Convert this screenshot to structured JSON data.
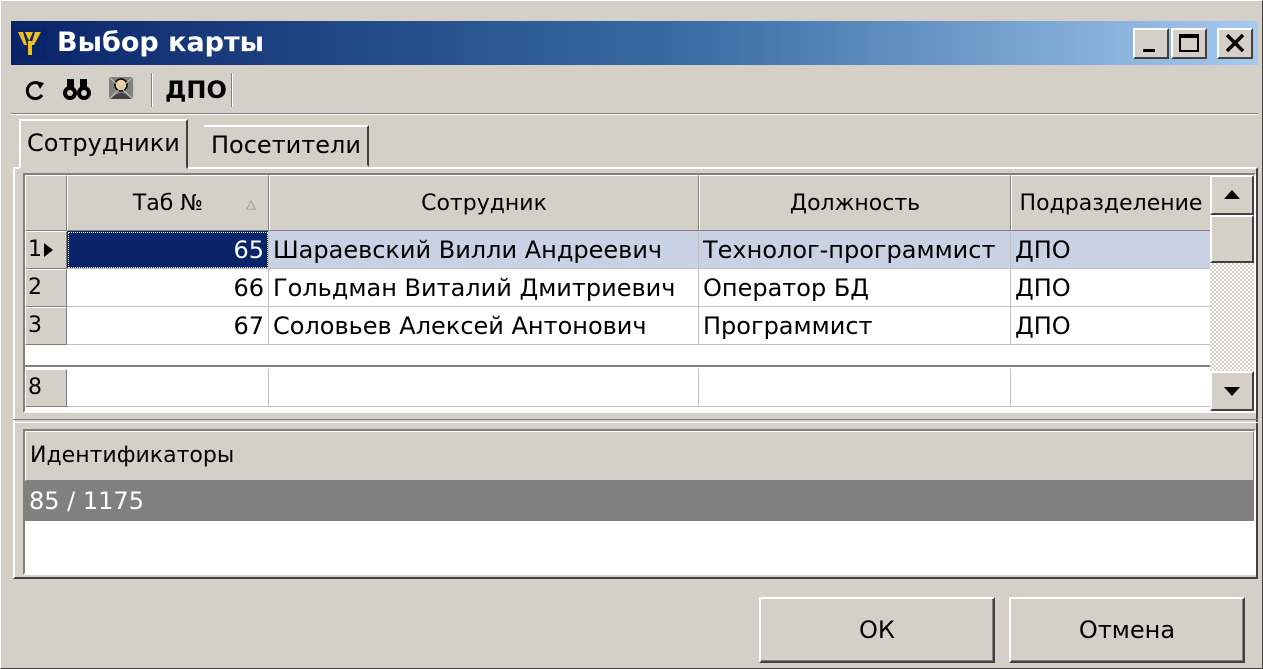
{
  "window": {
    "title": "Выбор карты",
    "icon": "app-logo-icon"
  },
  "toolbar": {
    "refresh_icon": "refresh-icon",
    "search_icon": "binoculars-icon",
    "filter_icon": "person-filter-icon",
    "department_label": "ДПО"
  },
  "tabs": [
    {
      "label": "Сотрудники",
      "active": true
    },
    {
      "label": "Посетители",
      "active": false
    }
  ],
  "table": {
    "columns": [
      "Таб №",
      "Сотрудник",
      "Должность",
      "Подразделение"
    ],
    "sort_indicator": "▵",
    "rows": [
      {
        "index": "1",
        "tab": "65",
        "employee": "Шараевский Вилли Андреевич",
        "position": "Технолог-программист",
        "department": "ДПО",
        "selected": true
      },
      {
        "index": "2",
        "tab": "66",
        "employee": "Гольдман Виталий Дмитриевич",
        "position": "Оператор БД",
        "department": "ДПО",
        "selected": false
      },
      {
        "index": "3",
        "tab": "67",
        "employee": "Соловьев Алексей Антонович",
        "position": "Программист",
        "department": "ДПО",
        "selected": false
      }
    ],
    "footer_row_index": "8"
  },
  "identifiers": {
    "header": "Идентификаторы",
    "rows": [
      "85 / 1175"
    ]
  },
  "buttons": {
    "ok": "ОК",
    "cancel": "Отмена"
  },
  "colors": {
    "title_start": "#0a246a",
    "title_end": "#a6caf0",
    "selected_row": "#c9d2e4",
    "id_row": "#808080"
  }
}
